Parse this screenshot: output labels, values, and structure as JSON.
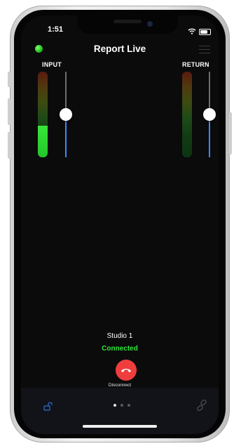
{
  "status_bar": {
    "time": "1:51"
  },
  "app": {
    "title": "Report Live"
  },
  "meters": {
    "input": {
      "label": "INPUT",
      "level": 0.37,
      "gain": 0.5
    },
    "return": {
      "label": "RETURN",
      "level": 0.0,
      "gain": 0.5
    }
  },
  "connection": {
    "station": "Studio 1",
    "status": "Connected",
    "disconnect_label": "Disconnect"
  },
  "pager": {
    "count": 3,
    "active_index": 0
  },
  "colors": {
    "connected": "#2ee63a",
    "live_indicator": "#21c21b",
    "disconnect": "#ef3d3d",
    "slider_active": "#3a8bff",
    "meter_fill": "#22c52a",
    "lock_icon": "#2f6fd8"
  },
  "icons": {
    "live": "green-dot-icon",
    "menu": "hamburger-menu-icon",
    "disconnect": "phone-hangup-icon",
    "lock": "unlock-icon",
    "link": "link-chain-icon",
    "wifi": "wifi-icon",
    "battery": "battery-icon"
  }
}
